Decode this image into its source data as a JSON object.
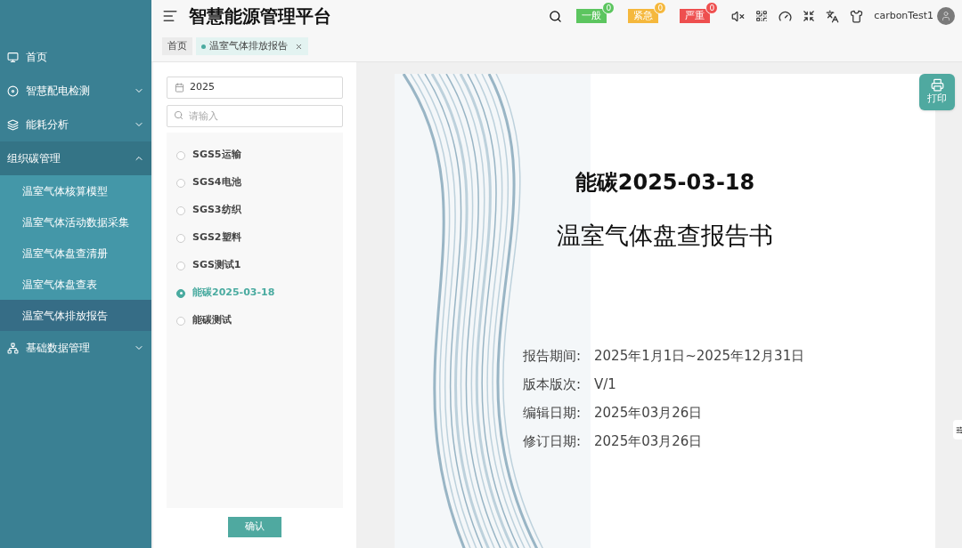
{
  "sidebar": {
    "items": [
      {
        "label": "首页",
        "kind": "link",
        "expanded": false
      },
      {
        "label": "智慧配电检测",
        "kind": "group",
        "expanded": false
      },
      {
        "label": "能耗分析",
        "kind": "group",
        "expanded": false
      },
      {
        "label": "组织碳管理",
        "kind": "group",
        "expanded": true,
        "children": [
          {
            "label": "温室气体核算模型",
            "selected": false
          },
          {
            "label": "温室气体活动数据采集",
            "selected": false
          },
          {
            "label": "温室气体盘查清册",
            "selected": false
          },
          {
            "label": "温室气体盘查表",
            "selected": false
          },
          {
            "label": "温室气体排放报告",
            "selected": true
          }
        ]
      },
      {
        "label": "基础数据管理",
        "kind": "group",
        "expanded": false
      }
    ]
  },
  "header": {
    "title": "智慧能源管理平台",
    "badges": [
      {
        "label": "一般",
        "count": "0",
        "color": "#5cc55f"
      },
      {
        "label": "紧急",
        "count": "0",
        "color": "#f5b83d"
      },
      {
        "label": "严重",
        "count": "0",
        "color": "#ee4f4f"
      }
    ],
    "user": "carbonTest1"
  },
  "tabs": [
    {
      "label": "首页",
      "selected": false,
      "closable": false
    },
    {
      "label": "温室气体排放报告",
      "selected": true,
      "closable": true
    }
  ],
  "filter": {
    "year": "2025",
    "search_placeholder": "请输入",
    "reports": [
      {
        "label": "SGS5运输",
        "selected": false
      },
      {
        "label": "SGS4电池",
        "selected": false
      },
      {
        "label": "SGS3纺织",
        "selected": false
      },
      {
        "label": "SGS2塑料",
        "selected": false
      },
      {
        "label": "SGS测试1",
        "selected": false
      },
      {
        "label": "能碳2025-03-18",
        "selected": true
      },
      {
        "label": "能碳测试",
        "selected": false
      }
    ],
    "confirm": "确认"
  },
  "document": {
    "title": "能碳2025-03-18",
    "subtitle": "温室气体盘查报告书",
    "fields": [
      {
        "label": "报告期间:",
        "value": "2025年1月1日~2025年12月31日"
      },
      {
        "label": "版本版次:",
        "value": "V/1"
      },
      {
        "label": "编辑日期:",
        "value": "2025年03月26日"
      },
      {
        "label": "修订日期:",
        "value": "2025年03月26日"
      }
    ],
    "print": "打印"
  }
}
